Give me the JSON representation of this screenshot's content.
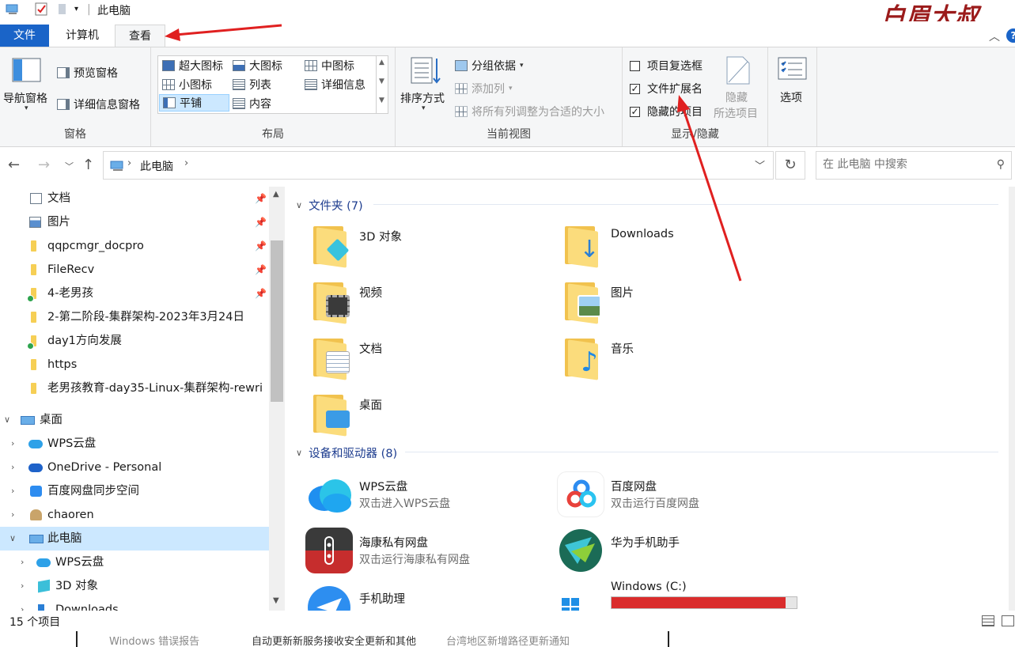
{
  "window": {
    "title": "此电脑",
    "watermark": "白眉大叔"
  },
  "tabs": [
    {
      "label": "文件"
    },
    {
      "label": "计算机"
    },
    {
      "label": "查看"
    }
  ],
  "ribbon": {
    "panes": {
      "nav_pane": "导航窗格",
      "preview_pane": "预览窗格",
      "details_pane": "详细信息窗格",
      "group_label": "窗格"
    },
    "layout": {
      "items": [
        "超大图标",
        "大图标",
        "中图标",
        "小图标",
        "列表",
        "详细信息",
        "平铺",
        "内容"
      ],
      "selected": "平铺",
      "group_label": "布局"
    },
    "current_view": {
      "sort_by": "排序方式",
      "group_by": "分组依据",
      "add_column": "添加列",
      "fit_columns": "将所有列调整为合适的大小",
      "group_label": "当前视图"
    },
    "show_hide": {
      "item_checkboxes": "项目复选框",
      "item_checkboxes_checked": false,
      "file_extensions": "文件扩展名",
      "file_extensions_checked": true,
      "hidden_items": "隐藏的项目",
      "hidden_items_checked": true,
      "hide_selected_1": "隐藏",
      "hide_selected_2": "所选项目",
      "group_label": "显示/隐藏"
    },
    "options": "选项"
  },
  "address": {
    "path": "此电脑",
    "search_placeholder": "在 此电脑 中搜索"
  },
  "navpane": {
    "quick": [
      {
        "label": "文档",
        "pinned": true
      },
      {
        "label": "图片",
        "pinned": true
      },
      {
        "label": "qqpcmgr_docpro",
        "pinned": true
      },
      {
        "label": "FileRecv",
        "pinned": true
      },
      {
        "label": "4-老男孩",
        "pinned": true
      },
      {
        "label": "2-第二阶段-集群架构-2023年3月24日",
        "pinned": false
      },
      {
        "label": "day1方向发展",
        "pinned": false
      },
      {
        "label": "https",
        "pinned": false
      },
      {
        "label": "老男孩教育-day35-Linux-集群架构-rewri",
        "pinned": false
      }
    ],
    "desktop": "桌面",
    "tree": [
      "WPS云盘",
      "OneDrive - Personal",
      "百度网盘同步空间",
      "chaoren",
      "此电脑",
      "WPS云盘",
      "3D 对象",
      "Downloads"
    ]
  },
  "content": {
    "folders_header": "文件夹 (7)",
    "folders": [
      "3D 对象",
      "Downloads",
      "视频",
      "图片",
      "文档",
      "音乐",
      "桌面"
    ],
    "devices_header": "设备和驱动器 (8)",
    "devices": [
      {
        "name": "WPS云盘",
        "sub": "双击进入WPS云盘"
      },
      {
        "name": "百度网盘",
        "sub": "双击运行百度网盘"
      },
      {
        "name": "海康私有网盘",
        "sub": "双击运行海康私有网盘"
      },
      {
        "name": "华为手机助手",
        "sub": ""
      },
      {
        "name": "手机助理",
        "sub": ""
      },
      {
        "name": "Windows (C:)",
        "sub": ""
      }
    ],
    "c_drive_used_fraction": 0.94
  },
  "status": {
    "count": "15 个项目"
  },
  "background": {
    "text1": "Windows 错误报告",
    "text2": "自动更新新服务接收安全更新和其他",
    "text3": "台湾地区新增路径更新通知"
  },
  "colors": {
    "file_tab": "#1a64c8",
    "selected_row": "#cce8ff",
    "arrow": "#e02020",
    "c_drive_fill": "#da2c2c"
  }
}
